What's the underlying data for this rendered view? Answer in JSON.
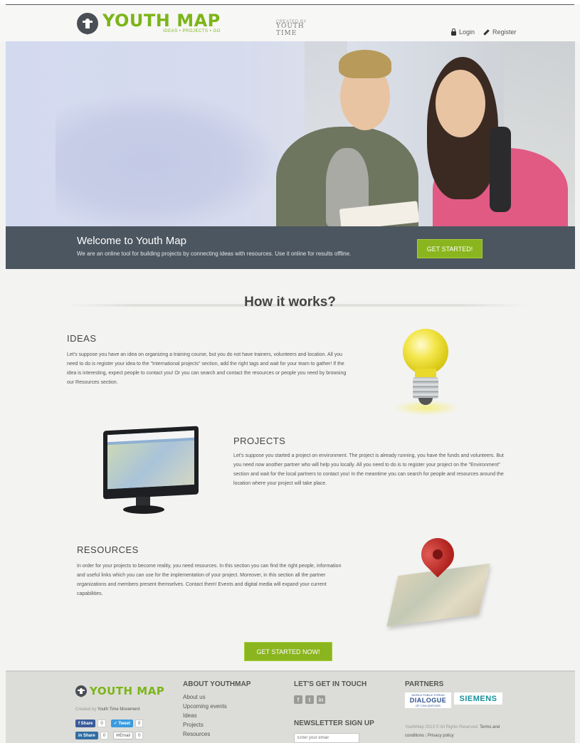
{
  "header": {
    "logo_title": "YOUTH MAP",
    "logo_tagline": "IDEAS • PROJECTS • GO",
    "created_by_small": "CREATED BY",
    "created_by_brand": "YOUTH TIME",
    "login_label": "Login",
    "register_label": "Register"
  },
  "welcome": {
    "title": "Welcome to Youth Map",
    "subtitle": "We are an online tool for building projects by connecting ideas with resources. Use it online for results offline.",
    "button_label": "GET STARTED!"
  },
  "how": {
    "title": "How it works?",
    "ideas": {
      "title": "IDEAS",
      "text": "Let's suppose you have an idea on organizing a training course, but you do not have trainers, volunteers and location. All you need to do is register your idea to the \"International projects\" section, add the right tags and wait for your team to gather! If the idea is interesting, expect people to contact you! Or you can search and contact the resources or people you need by browsing our Resources section."
    },
    "projects": {
      "title": "PROJECTS",
      "text": "Let's suppose you started a project on environment. The project is already running, you have the funds and volunteers. But you need now another partner who will help you locally. All you need to do is to register your project on the \"Environment\" section and wait for the local partners to contact you! In the meantime you can search for people and resources around the location where your project will take place."
    },
    "resources": {
      "title": "RESOURCES",
      "text": "In order for your projects to become reality, you need resources. In this section you can find the right people, information and useful links which you can use for the implementation of your project. Moreover, in this section all the partner organizations and members present themselves. Contact them! Events and digital media will expand your current capabilities."
    },
    "cta_label": "GET STARTED NOW!"
  },
  "footer": {
    "logo_title": "YOUTH MAP",
    "created_prefix": "Created by",
    "created_org": "Youth Time Movement",
    "share": {
      "fb_label": "Share",
      "fb_count": "0",
      "tw_label": "Tweet",
      "tw_count": "0",
      "in_label": "Share",
      "in_count": "0",
      "email_label": "Email",
      "email_count": "0"
    },
    "about_heading": "ABOUT YOUTHMAP",
    "about_links": [
      "About us",
      "Upcoming events",
      "Ideas",
      "Projects",
      "Resources"
    ],
    "contact_heading": "LET'S GET IN TOUCH",
    "social_icons": [
      "facebook-icon",
      "twitter-icon",
      "linkedin-icon"
    ],
    "newsletter_heading": "NEWSLETTER SIGN UP",
    "newsletter_placeholder": "Enter your email",
    "partners_heading": "PARTNERS",
    "partner1_small": "WORLD PUBLIC FORUM",
    "partner1_big": "DIALOGUE",
    "partner1_sub": "OF CIVILIZATIONS",
    "partner2": "SIEMENS",
    "copyright": "YouthMap 2013 © All Rights Reserved.",
    "terms_label": "Terms and conditions",
    "separator": "|",
    "privacy_label": "Privacy policy"
  },
  "colors": {
    "accent_green": "#8ab51e",
    "band_dark": "#4c5660",
    "logo_green": "#7cb518"
  }
}
